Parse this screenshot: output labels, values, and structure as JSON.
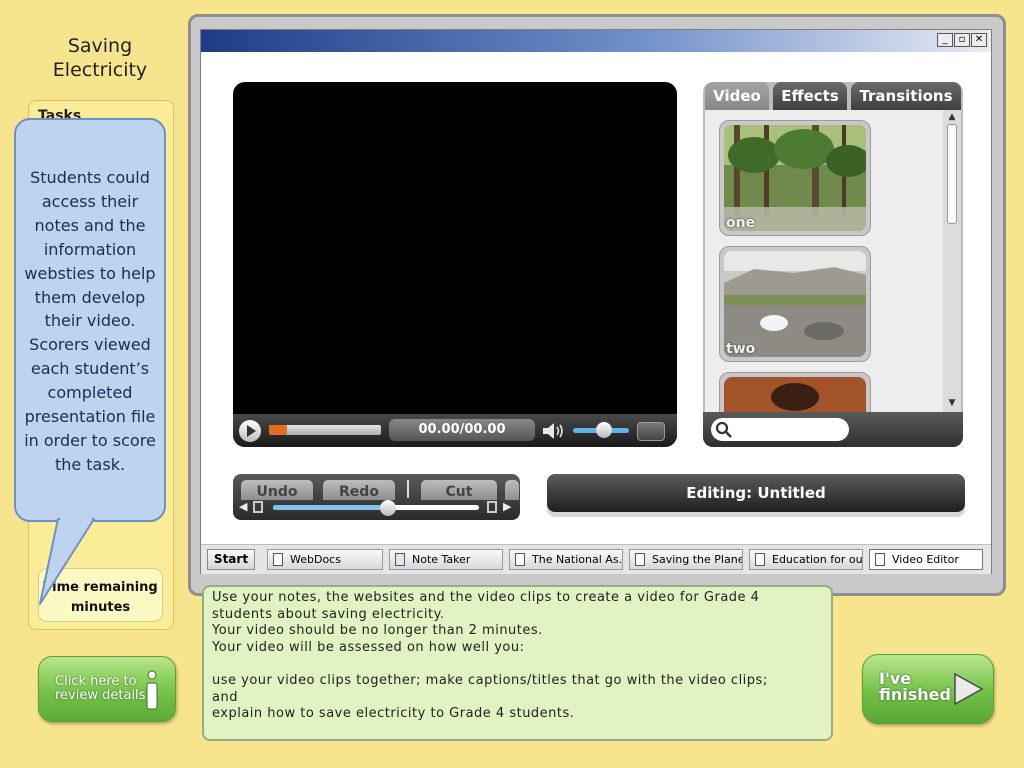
{
  "sidebar": {
    "title_line1": "Saving",
    "title_line2": "Electricity",
    "tasks_label": "Tasks",
    "time_remaining_line1": "Time remaining",
    "time_remaining_line2": "minutes",
    "review_button_line1": "Click here to",
    "review_button_line2": "review details"
  },
  "callout": {
    "text": "Students could access their notes and the information websties to help them develop their video. Scorers viewed each student’s completed presentation file  in order to score the task."
  },
  "window": {
    "controls": {
      "minimize": "_",
      "restore": "▫",
      "close": "✕"
    }
  },
  "video_player": {
    "time": "00.00/00.00",
    "progress": 0.16,
    "volume": 0.55
  },
  "media_panel": {
    "tabs": [
      {
        "label": "Video",
        "active": true
      },
      {
        "label": "Effects",
        "active": false
      },
      {
        "label": "Transitions",
        "active": false
      }
    ],
    "clips": [
      {
        "label": "one"
      },
      {
        "label": "two"
      },
      {
        "label": ""
      }
    ],
    "search_placeholder": ""
  },
  "edit_toolbar": {
    "undo": "Undo",
    "redo": "Redo",
    "cut": "Cut",
    "timeline_position": 0.56
  },
  "editing_bar": {
    "text": "Editing: Untitled"
  },
  "taskbar": {
    "start": "Start",
    "items": [
      {
        "label": "WebDocs",
        "icon": "document-icon"
      },
      {
        "label": "Note Taker",
        "icon": "notepad-icon"
      },
      {
        "label": "The National As...",
        "icon": "document-icon"
      },
      {
        "label": "Saving the Planet",
        "icon": "document-icon"
      },
      {
        "label": "Education for our...",
        "icon": "document-icon"
      },
      {
        "label": "Video Editor",
        "icon": "document-icon",
        "active": true
      }
    ]
  },
  "instructions": {
    "text": "Use your notes, the websites and the video clips to create a video for Grade 4\nstudents about saving electricity.\nYour video should be no longer than 2 minutes.\nYour video will be assessed on how well you:\n\nuse your video clips together; make captions/titles that go with the video clips;\nand\nexplain how to save electricity to Grade 4 students.\n\nClick on 'I've finished' when you have completed the task."
  },
  "finished_button": {
    "line1": "I've",
    "line2": "finished"
  },
  "colors": {
    "background": "#f7e58d",
    "callout": "#bdd3ef",
    "instructions_bg": "#e1f3c2",
    "button_green": "#72c049",
    "progress_orange": "#e0701b"
  }
}
